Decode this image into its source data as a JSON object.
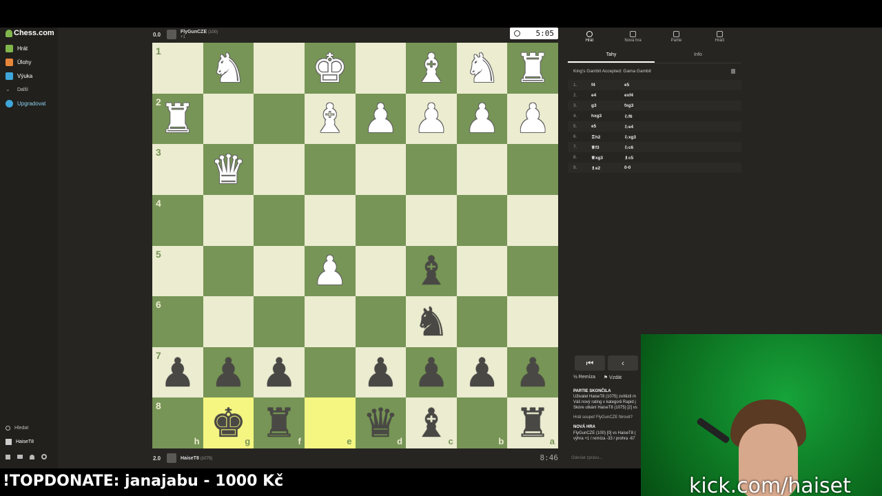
{
  "brand": "Chess.com",
  "sidebar": {
    "items": [
      {
        "label": "Hrát",
        "color": "#81b64c"
      },
      {
        "label": "Úlohy",
        "color": "#e6863b"
      },
      {
        "label": "Výuka",
        "color": "#3ea6d8"
      },
      {
        "label": "Další",
        "color": "#999999"
      },
      {
        "label": "Upgradovat",
        "color": "#3ea6d8"
      }
    ],
    "search": "Hledat",
    "user": "HaiseT8"
  },
  "top_player": {
    "score": "0.0",
    "name": "FlyGunCZE",
    "rating": "(100)",
    "sub": "+1",
    "clock": "5:05"
  },
  "bottom_player": {
    "score": "2.0",
    "name": "HaiseT8",
    "rating": "(1075)",
    "clock": "8:46"
  },
  "board": {
    "ranks": [
      "1",
      "2",
      "3",
      "4",
      "5",
      "6",
      "7",
      "8"
    ],
    "files": [
      "h",
      "g",
      "f",
      "e",
      "d",
      "c",
      "b",
      "a"
    ],
    "pieces": [
      [
        "",
        "♞w",
        "",
        "♚w",
        "",
        "♝w",
        "♞w",
        "♜w"
      ],
      [
        "♜w",
        "",
        "",
        "♝w",
        "♟w",
        "♟w",
        "♟w",
        "♟w"
      ],
      [
        "",
        "♛w",
        "",
        "",
        "",
        "",
        "",
        ""
      ],
      [
        "",
        "",
        "",
        "",
        "",
        "",
        "",
        ""
      ],
      [
        "",
        "",
        "",
        "♟w",
        "",
        "♝b",
        "",
        ""
      ],
      [
        "",
        "",
        "",
        "",
        "",
        "♞b",
        "",
        ""
      ],
      [
        "♟b",
        "♟b",
        "♟b",
        "",
        "♟b",
        "♟b",
        "♟b",
        "♟b"
      ],
      [
        "",
        "♚b",
        "♜b",
        "",
        "♛b",
        "♝b",
        "",
        "♜b"
      ]
    ],
    "highlight": [
      [
        7,
        1
      ],
      [
        7,
        3
      ]
    ],
    "colors": {
      "light": "#ebecd0",
      "dark": "#779556",
      "highlight": "#f5f682"
    }
  },
  "panel": {
    "tabs": [
      "Hrát",
      "Nová hra",
      "Partie",
      "Hráči"
    ],
    "subtabs": [
      "Tahy",
      "Info"
    ],
    "opening": "King's Gambit Accepted: Gama Gambit",
    "moves": [
      {
        "n": "1.",
        "w": "f4",
        "b": "e5"
      },
      {
        "n": "2.",
        "w": "e4",
        "b": "exf4"
      },
      {
        "n": "3.",
        "w": "g3",
        "b": "fxg3"
      },
      {
        "n": "4.",
        "w": "hxg3",
        "b": "♘f6"
      },
      {
        "n": "5.",
        "w": "e5",
        "b": "♘e4"
      },
      {
        "n": "6.",
        "w": "♖h2",
        "b": "♘xg3"
      },
      {
        "n": "7.",
        "w": "♕f3",
        "b": "♘c6"
      },
      {
        "n": "8.",
        "w": "♕xg3",
        "b": "♗c5"
      },
      {
        "n": "9.",
        "w": "♗e2",
        "b": "0-0"
      }
    ],
    "draw": "Remíza",
    "resign": "Vzdát",
    "game_over": {
      "title": "PARTIE SKONČILA",
      "line1": "Uživatel HaiseT8 (1075) zvítězil m",
      "line2": "Váš nový rating v kategorii Rapid j",
      "line3": "Skóre utkání HaiseT8 (1075) [2] vs",
      "line4": "Hrát soupeř FlyGunCZE férově?",
      "new_game": "NOVÁ HRA",
      "line5": "FlyGunCZE (100) [0] vs HaiseT8 (",
      "line6": "výhra +1 / remíza -33 / prohra -67"
    },
    "send_placeholder": "Odeslat zprávu..."
  },
  "overlay": {
    "donate": "!TOPDONATE: janajabu - 1000 Kč",
    "kick": "kick.com/haiset"
  }
}
